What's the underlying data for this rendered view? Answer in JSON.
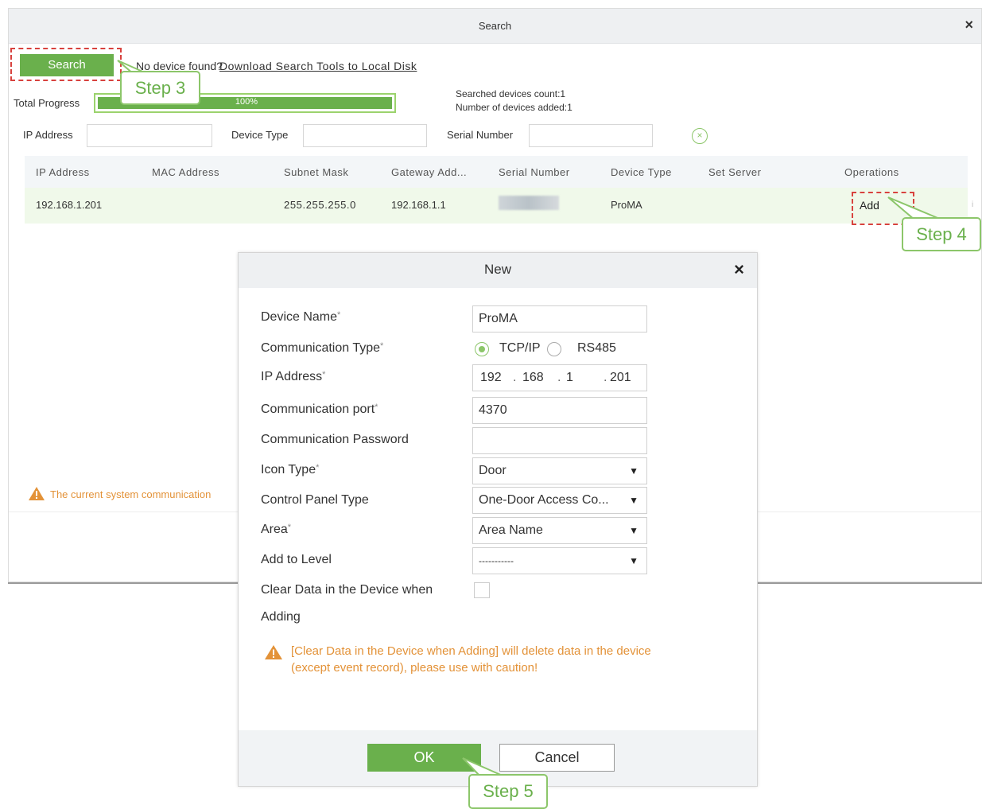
{
  "search_dialog": {
    "title": "Search",
    "close_symbol": "×",
    "search_button": "Search",
    "no_device_prompt": "No device found?",
    "download_link": "Download Search Tools to Local Disk",
    "total_progress_label": "Total Progress",
    "progress_percent": 100,
    "progress_text": "100%",
    "searched_count": "Searched devices count:1",
    "added_count": "Number of devices added:1",
    "filters": {
      "ip_label": "IP Address",
      "ip_value": "",
      "device_type_label": "Device Type",
      "device_type_value": "",
      "serial_label": "Serial Number",
      "serial_value": "",
      "clear_icon": "clear-filter-icon"
    },
    "table": {
      "headers": [
        "IP Address",
        "MAC Address",
        "Subnet Mask",
        "Gateway Add...",
        "Serial Number",
        "Device Type",
        "Set Server",
        "Operations"
      ],
      "row": {
        "ip": "192.168.1.201",
        "mac": "",
        "subnet": "255.255.255.0",
        "gateway": "192.168.1.1",
        "serial": "",
        "device_type": "ProMA",
        "set_server": "",
        "operation": "Add",
        "edge_mark": "i"
      }
    },
    "warning_text": "The current system communication"
  },
  "new_dialog": {
    "title": "New",
    "close_symbol": "×",
    "required_mark": "*",
    "fields": {
      "device_name_label": "Device Name",
      "device_name_value": "ProMA",
      "comm_type_label": "Communication Type",
      "comm_type_options": [
        "TCP/IP",
        "RS485"
      ],
      "comm_type_selected": "TCP/IP",
      "ip_label": "IP Address",
      "ip_segments": [
        "192",
        "168",
        "1",
        "201"
      ],
      "ip_separator": ".",
      "port_label": "Communication port",
      "port_value": "4370",
      "password_label": "Communication Password",
      "password_value": "",
      "icon_type_label": "Icon Type",
      "icon_type_value": "Door",
      "panel_type_label": "Control Panel Type",
      "panel_type_value": "One-Door Access Co...",
      "area_label": "Area",
      "area_value": "Area Name",
      "level_label": "Add to Level",
      "level_value": "-----------",
      "clear_data_label_line1": "Clear Data in the Device when",
      "clear_data_label_line2": "Adding",
      "clear_data_checked": false
    },
    "caution_line1": "[Clear Data in the Device when Adding] will delete data in the device",
    "caution_line2": "(except event record), please use with caution!",
    "ok_button": "OK",
    "cancel_button": "Cancel",
    "dropdown_caret": "▼"
  },
  "callouts": {
    "step3": "Step 3",
    "step4": "Step 4",
    "step5": "Step 5"
  },
  "colors": {
    "accent_green": "#6ab04c",
    "callout_green": "#8cc66a",
    "warning_orange": "#e39238",
    "highlight_red": "#d8423e"
  }
}
